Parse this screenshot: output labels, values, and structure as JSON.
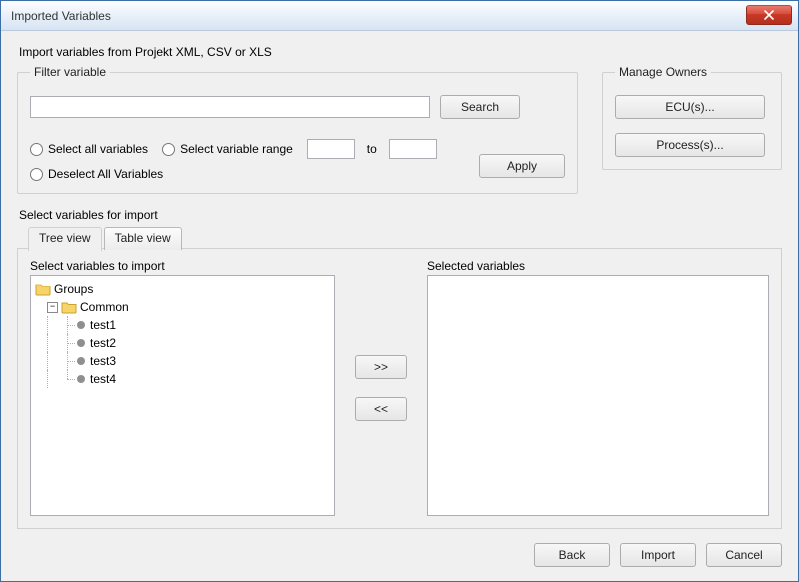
{
  "title": "Imported Variables",
  "intro": "Import variables from Projekt XML, CSV or XLS",
  "filter": {
    "legend": "Filter variable",
    "search_value": "",
    "search_button": "Search",
    "radios": {
      "select_all": "Select all variables",
      "select_range": "Select variable range",
      "deselect_all": "Deselect All Variables"
    },
    "range_from": "",
    "range_sep": "to",
    "range_to": "",
    "apply": "Apply"
  },
  "manage_owners": {
    "legend": "Manage Owners",
    "ecu_button": "ECU(s)...",
    "process_button": "Process(s)..."
  },
  "select_section_label": "Select variables for import",
  "tabs": {
    "tree": "Tree view",
    "table": "Table view",
    "active": "tree"
  },
  "columns": {
    "left_header": "Select variables to import",
    "right_header": "Selected variables",
    "move_right": ">>",
    "move_left": "<<"
  },
  "tree": {
    "root": "Groups",
    "group": "Common",
    "items": [
      "test1",
      "test2",
      "test3",
      "test4"
    ]
  },
  "footer": {
    "back": "Back",
    "import": "Import",
    "cancel": "Cancel"
  }
}
